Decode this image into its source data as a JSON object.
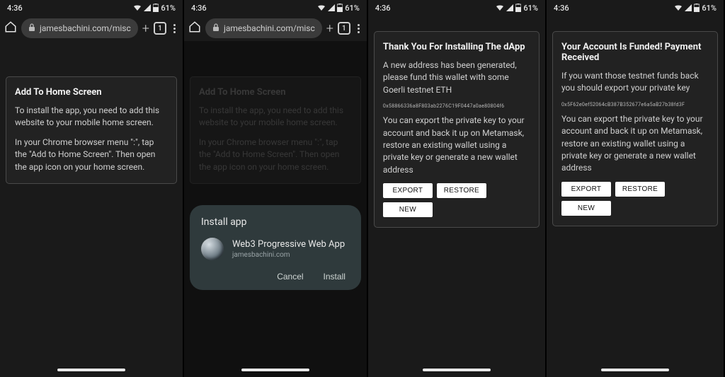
{
  "status": {
    "time": "4:36",
    "battery": "61%"
  },
  "chrome": {
    "url": "jamesbachini.com/misc/",
    "url_display": "jamesbachini.com/misc",
    "tab_count": "1"
  },
  "screen1": {
    "title": "Add To Home Screen",
    "p1": "To install the app, you need to add this website to your mobile home screen.",
    "p2": "In your Chrome browser menu \":\", tap the \"Add to Home Screen\". Then open the app icon on your home screen."
  },
  "install": {
    "sheet_title": "Install app",
    "app_name": "Web3 Progressive Web App",
    "app_domain": "jamesbachini.com",
    "cancel": "Cancel",
    "install": "Install"
  },
  "screen3": {
    "title": "Thank You For Installing The dApp",
    "p1": "A new address has been generated, please fund this wallet with some Goerli testnet ETH",
    "address": "0x58866336a8F803ab2276C19F0447a0ae80804f6",
    "p2": "You can export the private key to your account and back it up on Metamask, restore an existing wallet using a private key or generate a new wallet address",
    "btn_export": "EXPORT",
    "btn_restore": "RESTORE",
    "btn_new": "NEW"
  },
  "screen4": {
    "title": "Your Account Is Funded! Payment Received",
    "p1": "If you want those testnet funds back you should export your private key",
    "address": "0x5F62e0ef52064cB387B352677e6a5aB27b38fd3F",
    "p2": "You can export the private key to your account and back it up on Metamask, restore an existing wallet using a private key or generate a new wallet address",
    "btn_export": "EXPORT",
    "btn_restore": "RESTORE",
    "btn_new": "NEW"
  }
}
